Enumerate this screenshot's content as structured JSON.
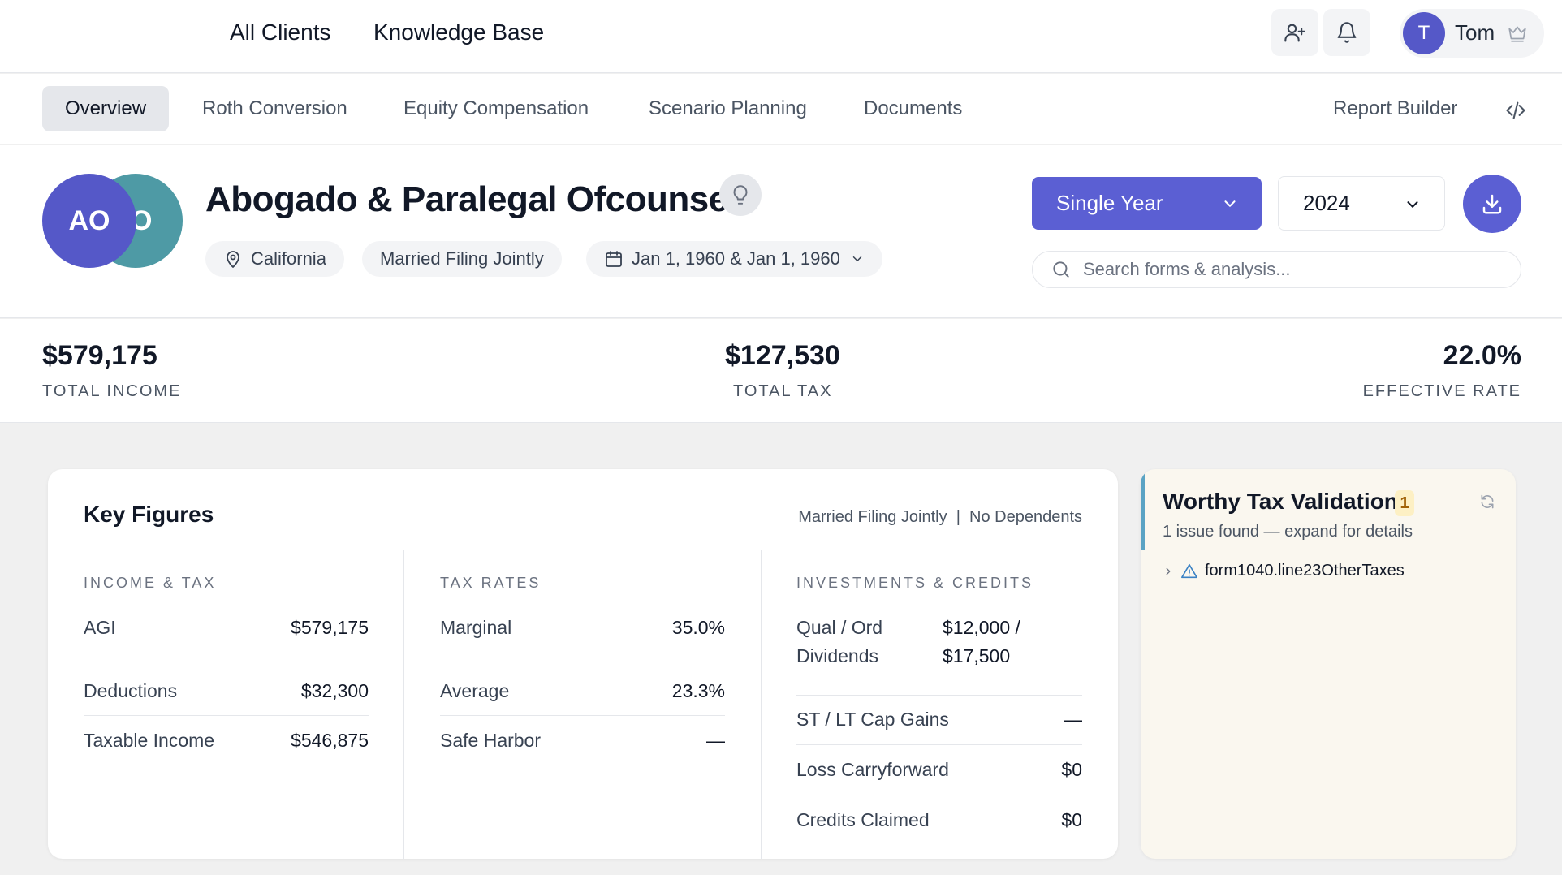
{
  "topnav": {
    "links": [
      "All Clients",
      "Knowledge Base"
    ],
    "user": {
      "initial": "T",
      "name": "Tom"
    }
  },
  "tabs": {
    "items": [
      "Overview",
      "Roth Conversion",
      "Equity Compensation",
      "Scenario Planning",
      "Documents"
    ],
    "active": "Overview",
    "report_builder": "Report Builder"
  },
  "client": {
    "initials_primary": "AO",
    "initials_secondary": "O",
    "name": "Abogado & Paralegal Ofcounsel",
    "state": "California",
    "filing_status": "Married Filing Jointly",
    "dates": "Jan 1, 1960 & Jan 1, 1960"
  },
  "controls": {
    "mode": "Single Year",
    "year": "2024",
    "search_placeholder": "Search forms & analysis..."
  },
  "summary": {
    "total_income": {
      "value": "$579,175",
      "label": "TOTAL INCOME"
    },
    "total_tax": {
      "value": "$127,530",
      "label": "TOTAL TAX"
    },
    "effective_rate": {
      "value": "22.0%",
      "label": "EFFECTIVE RATE"
    }
  },
  "key_figures": {
    "title": "Key Figures",
    "meta": "Married Filing Jointly  |  No Dependents",
    "income_tax": {
      "heading": "INCOME & TAX",
      "rows": [
        {
          "label": "AGI",
          "value": "$579,175"
        },
        {
          "label": "Deductions",
          "value": "$32,300"
        },
        {
          "label": "Taxable Income",
          "value": "$546,875"
        }
      ]
    },
    "tax_rates": {
      "heading": "TAX RATES",
      "rows": [
        {
          "label": "Marginal",
          "value": "35.0%"
        },
        {
          "label": "Average",
          "value": "23.3%"
        },
        {
          "label": "Safe Harbor",
          "value": "—"
        }
      ]
    },
    "investments": {
      "heading": "INVESTMENTS & CREDITS",
      "rows": [
        {
          "label_line1": "Qual / Ord",
          "label_line2": "Dividends",
          "value_line1": "$12,000 /",
          "value_line2": "$17,500"
        },
        {
          "label": "ST / LT Cap Gains",
          "value": "—"
        },
        {
          "label": "Loss Carryforward",
          "value": "$0"
        },
        {
          "label": "Credits Claimed",
          "value": "$0"
        }
      ]
    }
  },
  "validation": {
    "title": "Worthy Tax Validation",
    "count": "1",
    "subtitle": "1 issue found — expand for details",
    "issues": [
      "form1040.line23OtherTaxes"
    ]
  },
  "colors": {
    "accent": "#5b5fd3",
    "avatar_secondary": "#4e9aa5",
    "validation_bar": "#5aa3c4",
    "validation_bg": "#faf7ef"
  }
}
